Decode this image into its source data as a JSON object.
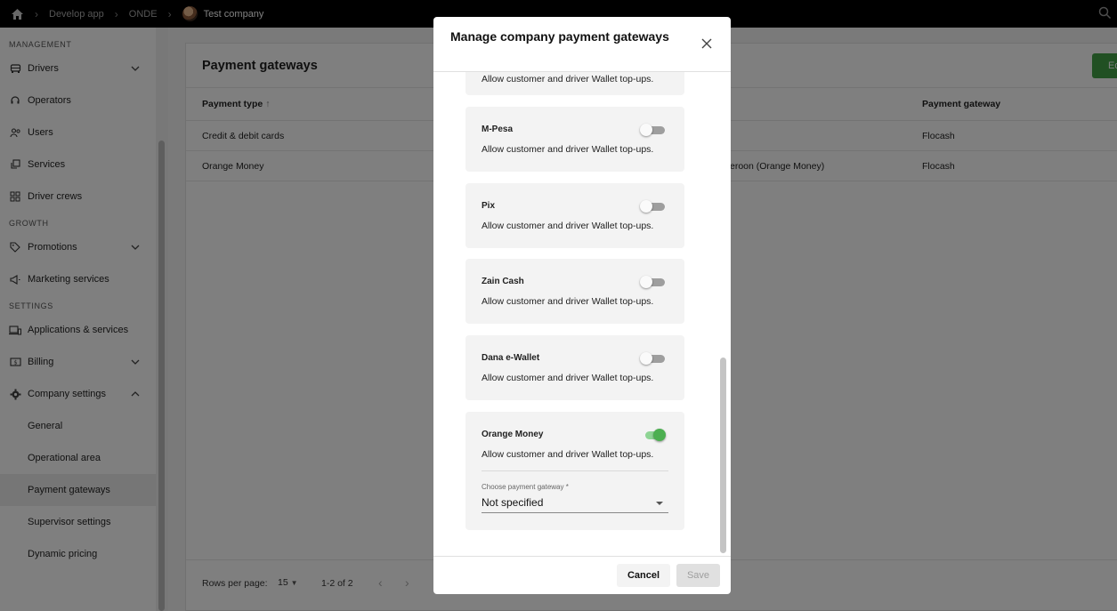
{
  "topbar": {
    "breadcrumb": [
      "Develop app",
      "ONDE"
    ],
    "company": "Test company"
  },
  "sidebar": {
    "management_label": "MANAGEMENT",
    "growth_label": "GROWTH",
    "settings_label": "SETTINGS",
    "items": {
      "drivers": "Drivers",
      "operators": "Operators",
      "users": "Users",
      "services": "Services",
      "driver_crews": "Driver crews",
      "promotions": "Promotions",
      "marketing": "Marketing services",
      "applications": "Applications & services",
      "billing": "Billing",
      "company_settings": "Company settings",
      "general": "General",
      "operational_area": "Operational area",
      "payment_gateways": "Payment gateways",
      "supervisor_settings": "Supervisor settings",
      "dynamic_pricing": "Dynamic pricing"
    }
  },
  "main": {
    "title": "Payment gateways",
    "edit_label": "Edit",
    "columns": {
      "payment_type": "Payment type",
      "payment_gateway": "Payment gateway"
    },
    "rows": [
      {
        "type": "Credit & debit cards",
        "middle": "",
        "gateway": "Flocash"
      },
      {
        "type": "Orange Money",
        "middle": "eroon (Orange Money)",
        "gateway": "Flocash"
      }
    ],
    "footer": {
      "rows_per_page_label": "Rows per page:",
      "rows_per_page": "15",
      "range": "1-2 of 2"
    }
  },
  "dialog": {
    "title": "Manage company payment gateways",
    "top_desc": "Allow customer and driver Wallet top-ups.",
    "gateways": [
      {
        "name": "M-Pesa",
        "desc": "Allow customer and driver Wallet top-ups.",
        "enabled": false
      },
      {
        "name": "Pix",
        "desc": "Allow customer and driver Wallet top-ups.",
        "enabled": false
      },
      {
        "name": "Zain Cash",
        "desc": "Allow customer and driver Wallet top-ups.",
        "enabled": false
      },
      {
        "name": "Dana e-Wallet",
        "desc": "Allow customer and driver Wallet top-ups.",
        "enabled": false
      },
      {
        "name": "Orange Money",
        "desc": "Allow customer and driver Wallet top-ups.",
        "enabled": true
      }
    ],
    "field_label": "Choose payment gateway *",
    "field_value": "Not specified",
    "cancel_label": "Cancel",
    "save_label": "Save"
  },
  "colors": {
    "accent_green": "#4caf50",
    "annotation_arrow": "#d32f2f"
  }
}
